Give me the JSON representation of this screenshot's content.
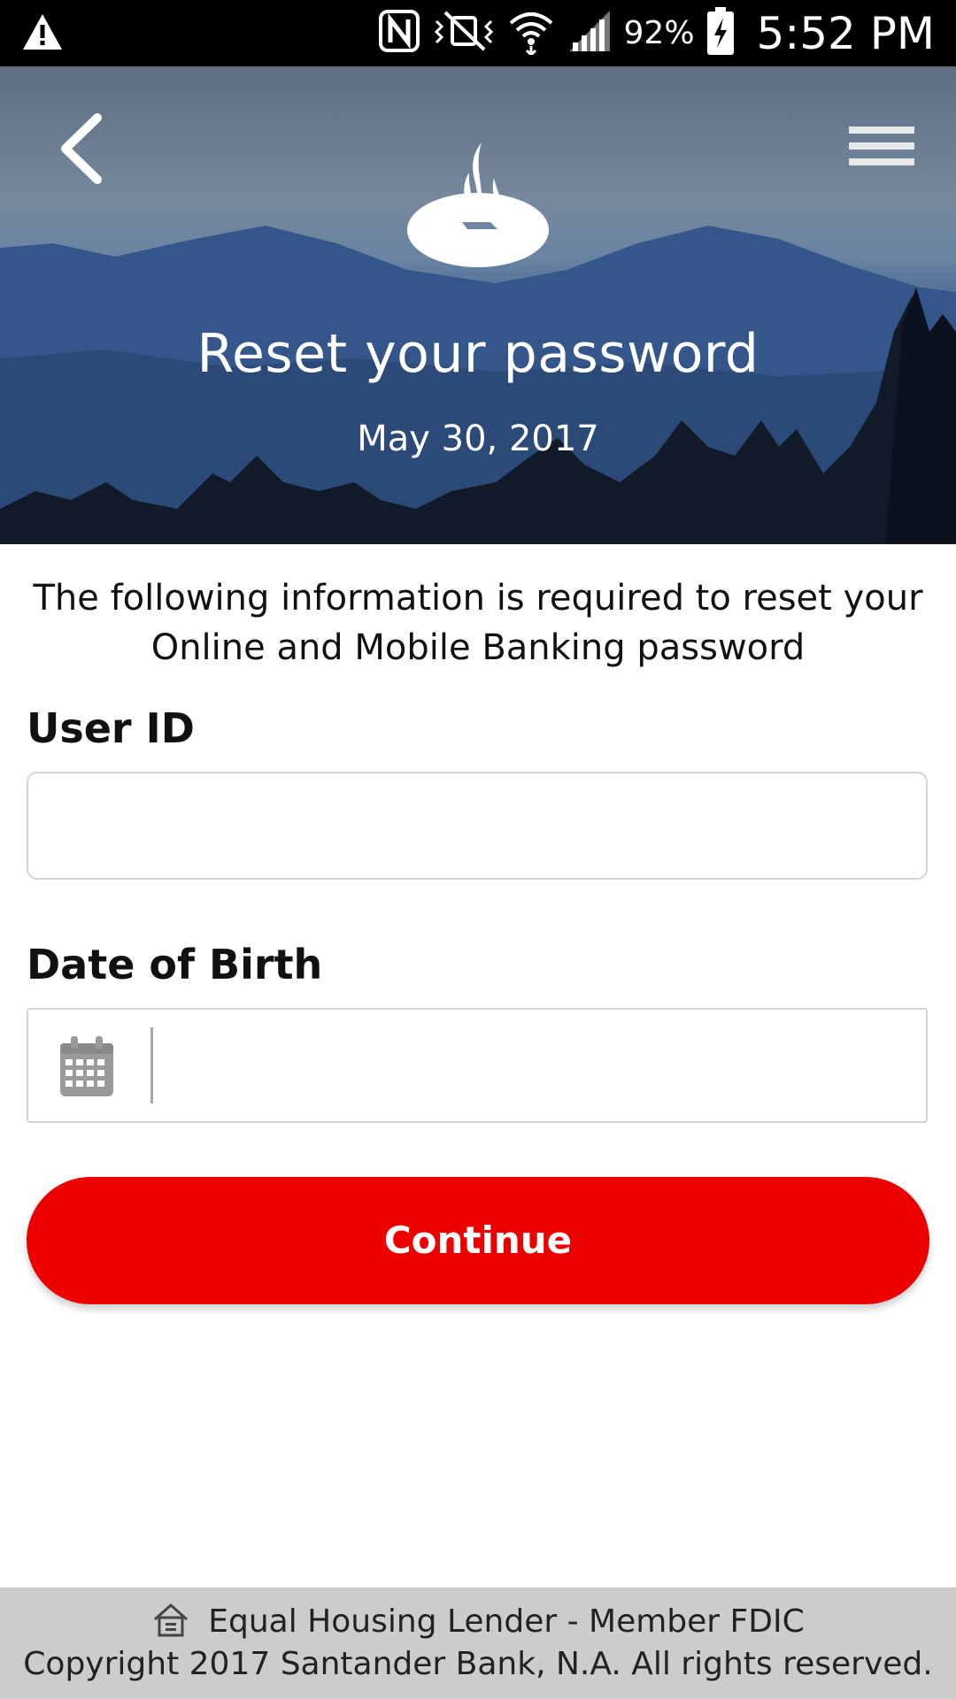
{
  "status_bar": {
    "battery_percent": "92%",
    "time": "5:52 PM"
  },
  "header": {
    "title": "Reset your password",
    "date": "May 30, 2017"
  },
  "form": {
    "intro_text": "The following information is required to reset your Online and Mobile Banking password",
    "user_id_label": "User ID",
    "user_id_value": "",
    "dob_label": "Date of Birth",
    "dob_value": "",
    "continue_label": "Continue"
  },
  "footer": {
    "line1": "Equal Housing Lender - Member FDIC",
    "line2": "Copyright 2017 Santander Bank, N.A. All rights reserved."
  },
  "colors": {
    "accent": "#ec0000",
    "footer_bg": "#cccccc"
  }
}
